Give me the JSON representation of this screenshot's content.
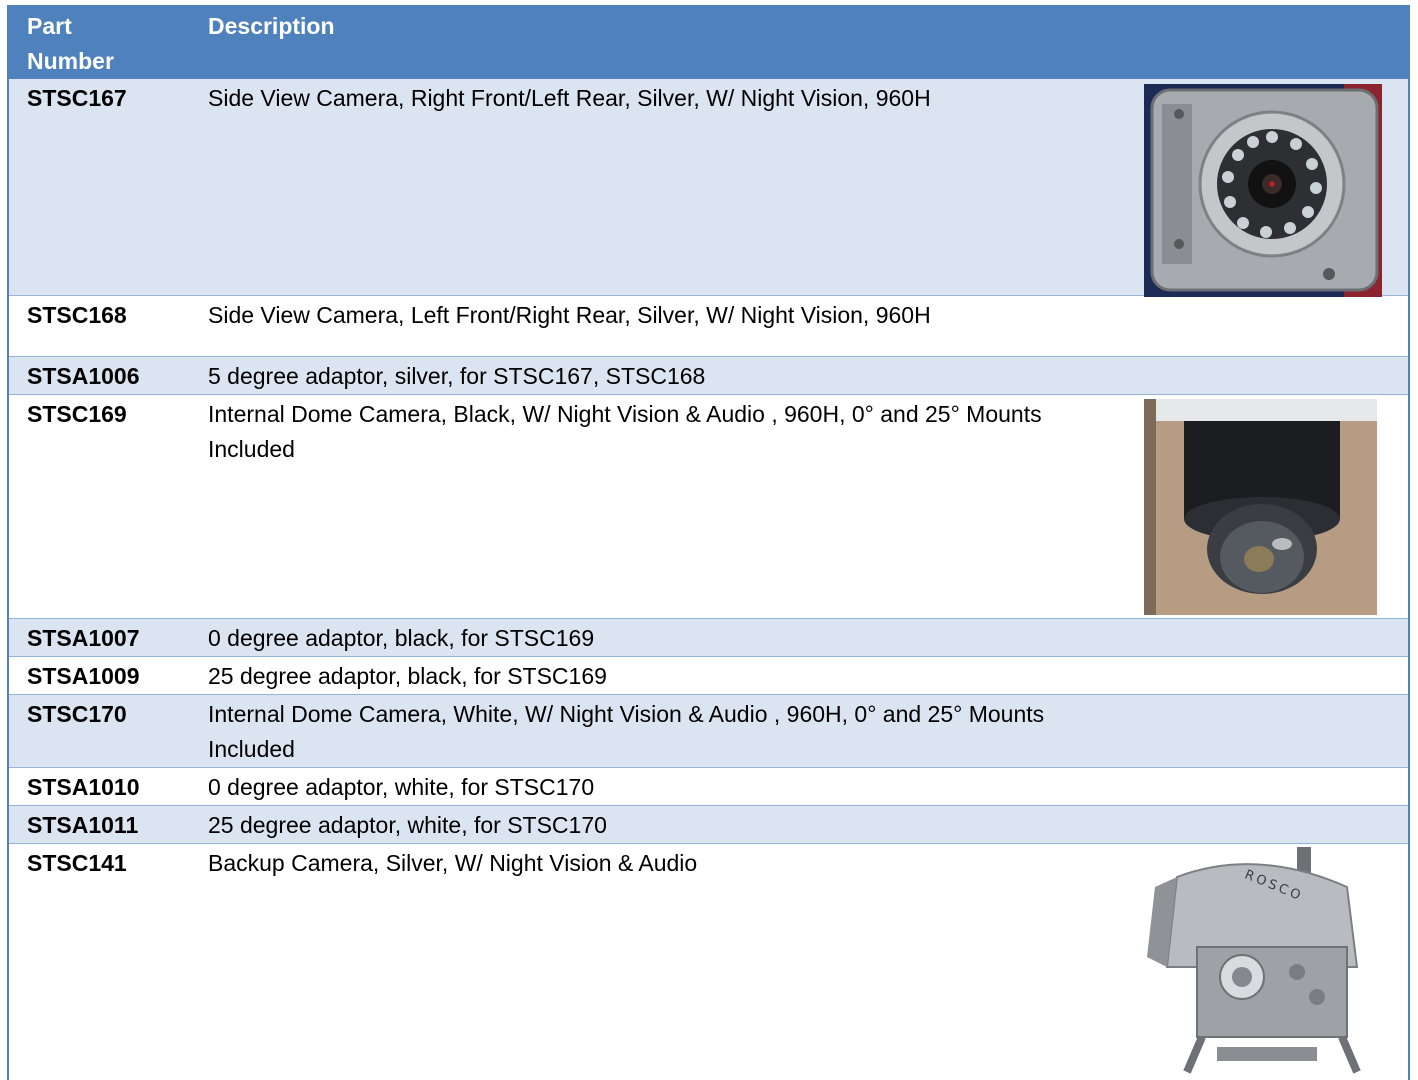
{
  "table": {
    "headers": {
      "part_number": "Part\nNumber",
      "description": "Description"
    },
    "rows": [
      {
        "part": "STSC167",
        "description": "Side View Camera, Right Front/Left Rear, Silver, W/ Night Vision, 960H",
        "image": "side-view-camera-photo"
      },
      {
        "part": "STSC168",
        "description": "Side View Camera, Left Front/Right Rear, Silver, W/ Night Vision, 960H"
      },
      {
        "part": "STSA1006",
        "description": "5 degree adaptor, silver, for STSC167, STSC168"
      },
      {
        "part": "STSC169",
        "description": "Internal Dome Camera, Black,  W/ Night Vision & Audio , 960H, 0° and 25° Mounts Included",
        "image": "dome-camera-photo"
      },
      {
        "part": "STSA1007",
        "description": "0 degree adaptor, black, for STSC169"
      },
      {
        "part": "STSA1009",
        "description": "25 degree adaptor, black, for STSC169"
      },
      {
        "part": "STSC170",
        "description": "Internal Dome Camera, White,   W/ Night Vision & Audio , 960H, 0° and 25° Mounts Included"
      },
      {
        "part": "STSA1010",
        "description": "0 degree adaptor, white, for STSC170"
      },
      {
        "part": "STSA1011",
        "description": "25 degree adaptor, white, for STSC170"
      },
      {
        "part": "STSC141",
        "description": "Backup Camera, Silver, W/ Night Vision & Audio",
        "image": "backup-camera-photo"
      }
    ]
  },
  "backup_camera_logo": "ROSCO",
  "colors": {
    "header": "#4f81bd",
    "band": "#dbe5f1",
    "rule": "#95b3d7"
  }
}
